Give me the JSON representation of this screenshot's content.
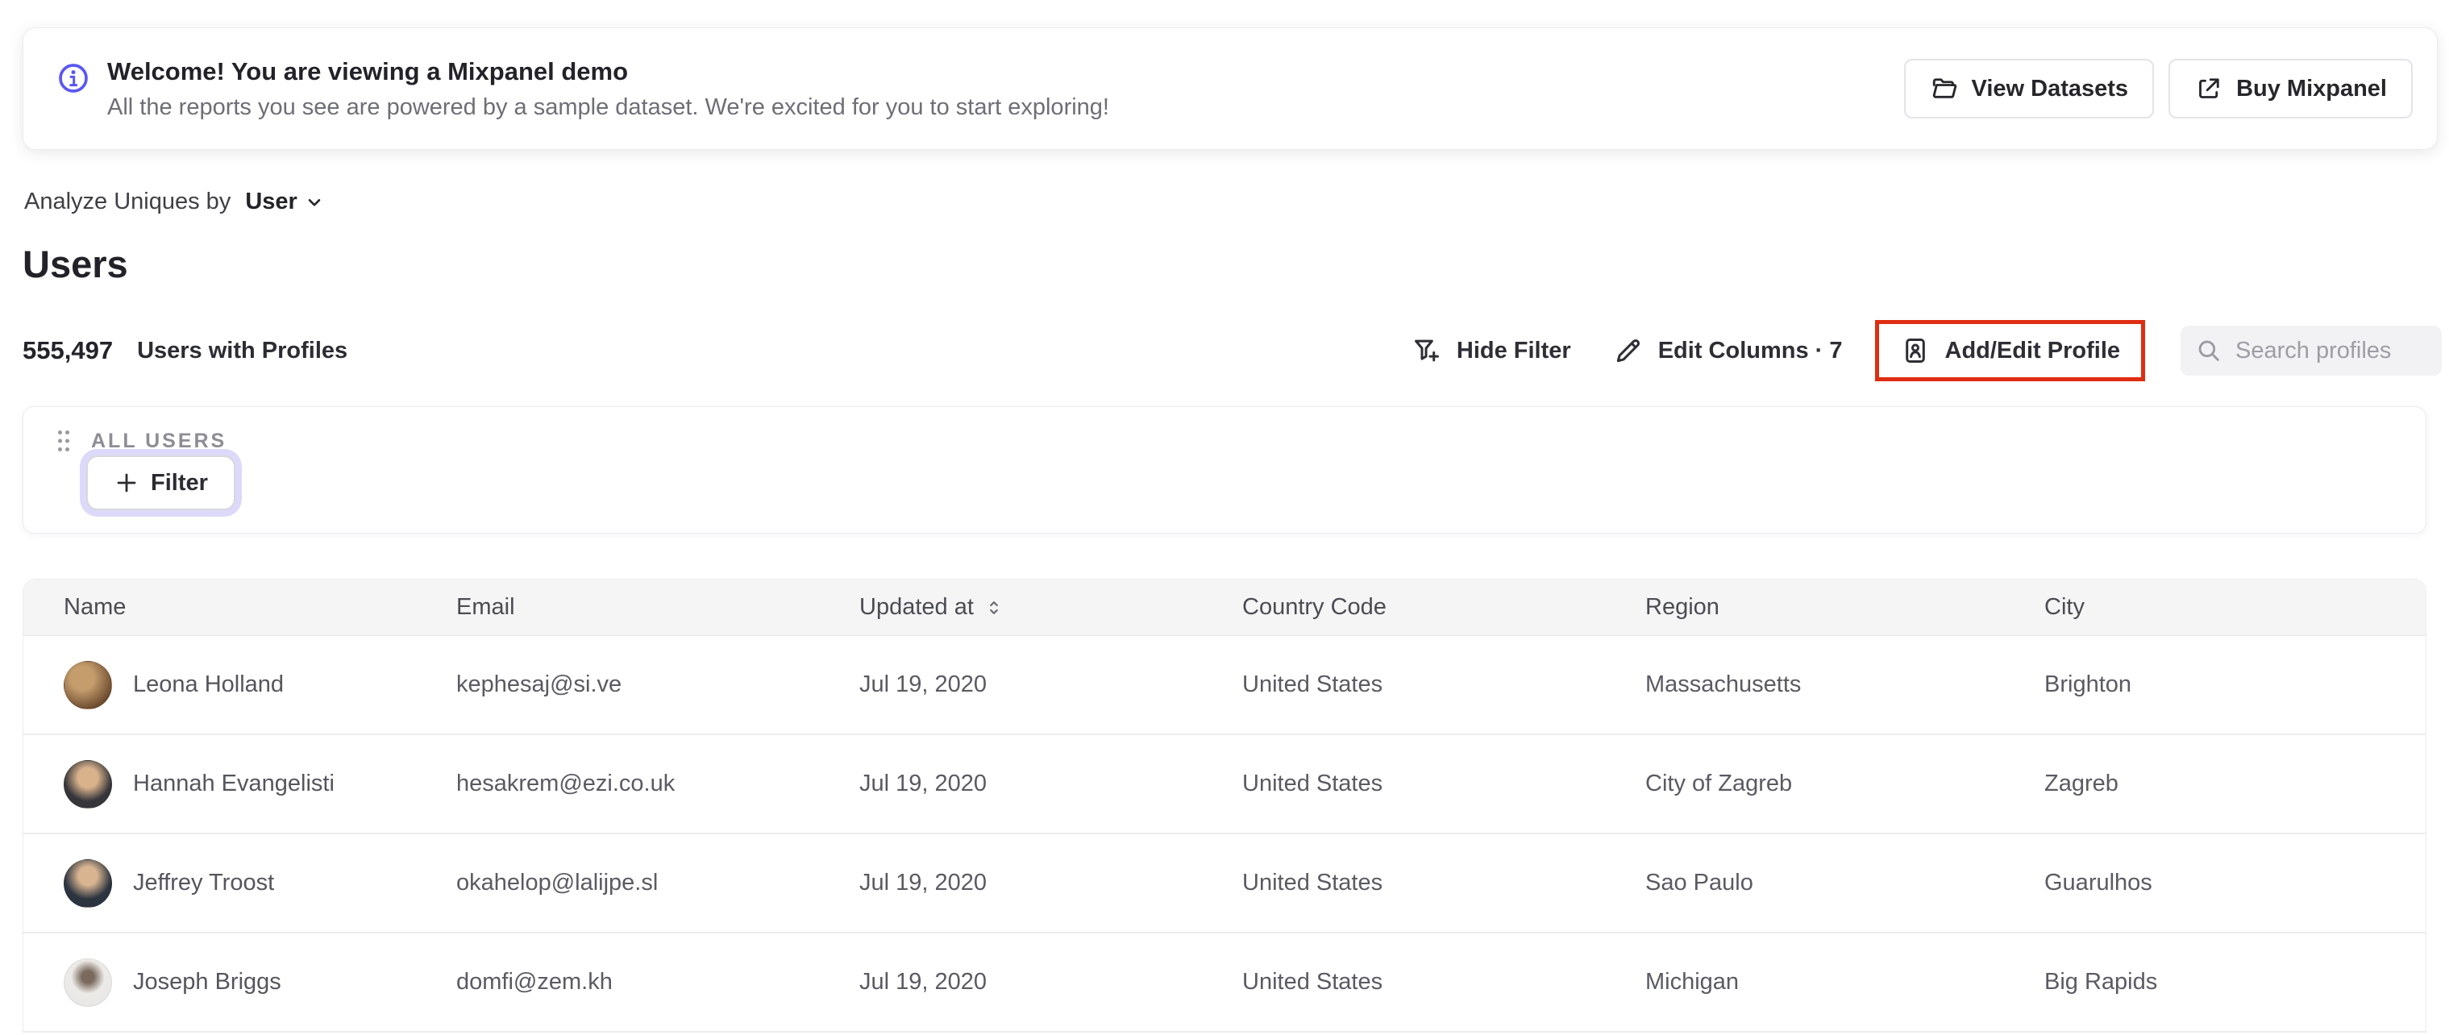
{
  "banner": {
    "title": "Welcome! You are viewing a Mixpanel demo",
    "subtitle": "All the reports you see are powered by a sample dataset. We're excited for you to start exploring!",
    "view_datasets_label": "View Datasets",
    "buy_mixpanel_label": "Buy Mixpanel"
  },
  "controls": {
    "analyze_label": "Analyze Uniques by",
    "analyze_value": "User"
  },
  "page": {
    "title": "Users"
  },
  "stats": {
    "count": "555,497",
    "label": "Users with Profiles"
  },
  "toolbar": {
    "hide_filter_label": "Hide Filter",
    "edit_columns_label": "Edit Columns · 7",
    "add_edit_profile_label": "Add/Edit Profile",
    "search_placeholder": "Search profiles"
  },
  "filter_panel": {
    "group_label": "ALL USERS",
    "filter_button_label": "Filter"
  },
  "table": {
    "columns": {
      "name": "Name",
      "email": "Email",
      "updated": "Updated at",
      "country": "Country Code",
      "region": "Region",
      "city": "City"
    },
    "rows": [
      {
        "name": "Leona Holland",
        "email": "kephesaj@si.ve",
        "updated_at": "Jul 19, 2020",
        "country": "United States",
        "region": "Massachusetts",
        "city": "Brighton",
        "avatar": "photo-woman-brown-tones"
      },
      {
        "name": "Hannah Evangelisti",
        "email": "hesakrem@ezi.co.uk",
        "updated_at": "Jul 19, 2020",
        "country": "United States",
        "region": "City of Zagreb",
        "city": "Zagreb",
        "avatar": "photo-woman-dark-shirt"
      },
      {
        "name": "Jeffrey Troost",
        "email": "okahelop@lalijpe.sl",
        "updated_at": "Jul 19, 2020",
        "country": "United States",
        "region": "Sao Paulo",
        "city": "Guarulhos",
        "avatar": "photo-man-suit"
      },
      {
        "name": "Joseph Briggs",
        "email": "domfi@zem.kh",
        "updated_at": "Jul 19, 2020",
        "country": "United States",
        "region": "Michigan",
        "city": "Big Rapids",
        "avatar": "photo-man-light-bg"
      }
    ]
  },
  "colors": {
    "accent_purple": "#5a57f2",
    "annotation_red": "#df2d12",
    "focus_ring_lavender": "#dcd9fa",
    "header_bg": "#f5f5f6",
    "search_bg": "#f2f2f4"
  }
}
